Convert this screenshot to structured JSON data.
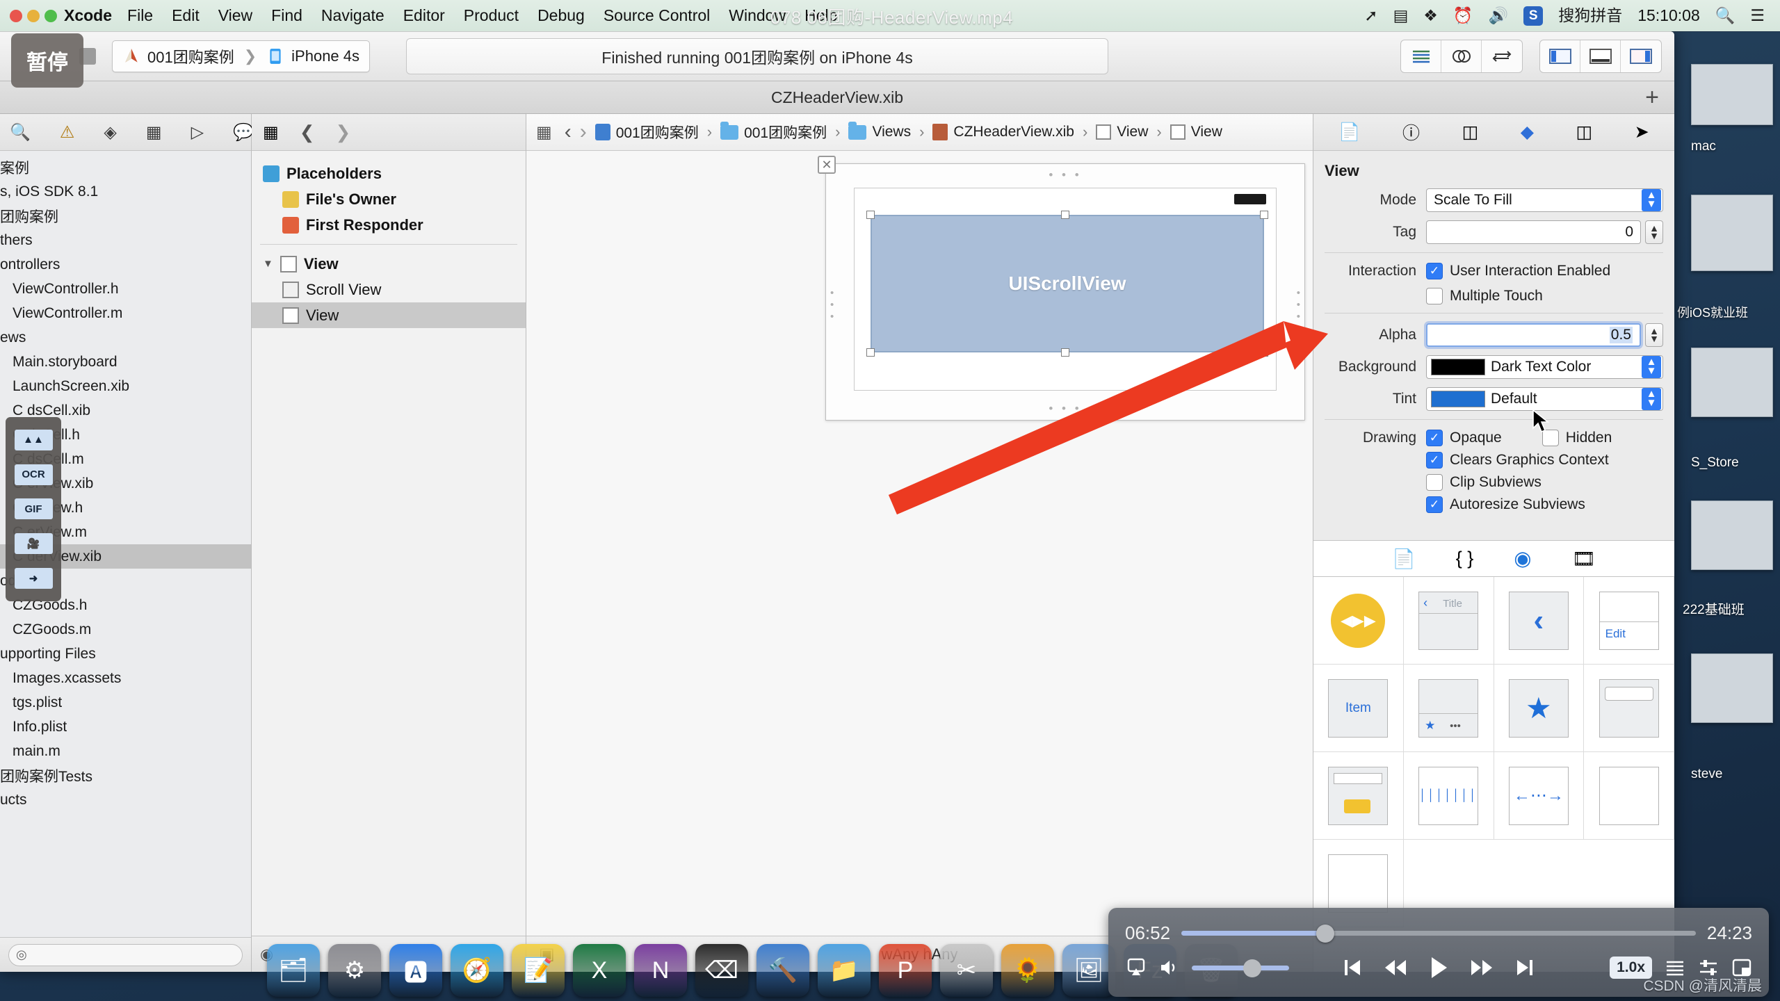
{
  "menubar": {
    "app_name": "Xcode",
    "items": [
      "File",
      "Edit",
      "View",
      "Find",
      "Navigate",
      "Editor",
      "Product",
      "Debug",
      "Source Control",
      "Window",
      "Help"
    ],
    "status_icons": [
      "airplay-icon",
      "facetime-camera-icon",
      "dropbox-icon",
      "time-machine-icon",
      "volume-icon",
      "sogou-input-icon",
      "search-icon",
      "notification-center-icon"
    ],
    "input_method": "搜狗拼音",
    "sogou_badge": "S",
    "clock": "15:10:08"
  },
  "video_overlay": {
    "filename": "078 06团购-HeaderView.mp4",
    "watermark": "CSDN @清风清晨"
  },
  "recorder": {
    "pause_label": "暂停",
    "buttons": [
      "screenshot-icon",
      "OCR",
      "GIF",
      "video-record-icon",
      "share-icon"
    ]
  },
  "xcode": {
    "toolbar": {
      "stop_button": "stop-button",
      "scheme_name": "001团购案例",
      "device_name": "iPhone 4s",
      "activity_status": "Finished running 001团购案例 on iPhone 4s",
      "editor_segments": [
        "standard-editor-icon",
        "assistant-editor-icon",
        "version-editor-icon"
      ],
      "view_segments": [
        "toggle-navigator-icon",
        "toggle-debug-area-icon",
        "toggle-utilities-icon"
      ]
    },
    "tabbar": {
      "title": "CZHeaderView.xib",
      "add_tab": "+"
    },
    "navigator": {
      "tabs": [
        "project-navigator-icon",
        "issue-navigator-icon",
        "test-navigator-icon",
        "debug-navigator-icon",
        "breakpoint-navigator-icon",
        "report-navigator-icon"
      ],
      "items": [
        {
          "label": "案例",
          "indent": 0,
          "selected": false
        },
        {
          "label": "s, iOS SDK 8.1",
          "indent": 0,
          "selected": false
        },
        {
          "label": "团购案例",
          "indent": 0,
          "selected": false
        },
        {
          "label": "thers",
          "indent": 0,
          "selected": false
        },
        {
          "label": "ontrollers",
          "indent": 0,
          "selected": false
        },
        {
          "label": "ViewController.h",
          "indent": 1,
          "selected": false
        },
        {
          "label": "ViewController.m",
          "indent": 1,
          "selected": false
        },
        {
          "label": "ews",
          "indent": 0,
          "selected": false
        },
        {
          "label": "Main.storyboard",
          "indent": 1,
          "selected": false
        },
        {
          "label": "LaunchScreen.xib",
          "indent": 1,
          "selected": false
        },
        {
          "label": "C        dsCell.xib",
          "indent": 1,
          "selected": false
        },
        {
          "label": "C        dsCell.h",
          "indent": 1,
          "selected": false
        },
        {
          "label": "C        dsCell.m",
          "indent": 1,
          "selected": false
        },
        {
          "label": "C        erView.xib",
          "indent": 1,
          "selected": false
        },
        {
          "label": "C        erView.h",
          "indent": 1,
          "selected": false
        },
        {
          "label": "C        erView.m",
          "indent": 1,
          "selected": false
        },
        {
          "label": "C        derView.xib",
          "indent": 1,
          "selected": true
        },
        {
          "label": "odels",
          "indent": 0,
          "selected": false
        },
        {
          "label": "CZGoods.h",
          "indent": 1,
          "selected": false
        },
        {
          "label": "CZGoods.m",
          "indent": 1,
          "selected": false
        },
        {
          "label": "upporting Files",
          "indent": 0,
          "selected": false
        },
        {
          "label": "Images.xcassets",
          "indent": 1,
          "selected": false
        },
        {
          "label": "tgs.plist",
          "indent": 1,
          "selected": false
        },
        {
          "label": "Info.plist",
          "indent": 1,
          "selected": false
        },
        {
          "label": "main.m",
          "indent": 1,
          "selected": false
        },
        {
          "label": "团购案例Tests",
          "indent": 0,
          "selected": false
        },
        {
          "label": "ucts",
          "indent": 0,
          "selected": false
        }
      ]
    },
    "outline": {
      "rows": [
        {
          "label": "Placeholders",
          "icon": "blue-cube-icon",
          "indent": 0,
          "bold": true,
          "selected": false
        },
        {
          "label": "File's Owner",
          "icon": "yellow-cube-icon",
          "indent": 1,
          "bold": true,
          "selected": false
        },
        {
          "label": "First Responder",
          "icon": "red-cube-icon",
          "indent": 1,
          "bold": true,
          "selected": false
        },
        {
          "label": "View",
          "icon": "view-icon",
          "indent": 0,
          "bold": true,
          "selected": false
        },
        {
          "label": "Scroll View",
          "icon": "scrollview-icon",
          "indent": 1,
          "bold": false,
          "selected": false
        },
        {
          "label": "View",
          "icon": "view-icon",
          "indent": 1,
          "bold": false,
          "selected": true
        }
      ]
    },
    "jumpbar": {
      "crumbs": [
        "001团购案例",
        "001团购案例",
        "Views",
        "CZHeaderView.xib",
        "View",
        "View"
      ],
      "icons": [
        "project-icon",
        "folder-icon",
        "folder-icon",
        "xib-icon",
        "view-icon",
        "view-icon"
      ]
    },
    "canvas": {
      "scrollview_label": "UIScrollView",
      "size_class": "wAny hAny"
    },
    "inspector": {
      "tabs": [
        "file-inspector-icon",
        "quick-help-icon",
        "identity-inspector-icon",
        "attributes-inspector-icon",
        "size-inspector-icon",
        "connections-inspector-icon"
      ],
      "section_title": "View",
      "mode_label": "Mode",
      "mode_value": "Scale To Fill",
      "tag_label": "Tag",
      "tag_value": "0",
      "interaction_label": "Interaction",
      "user_interaction_enabled": {
        "label": "User Interaction Enabled",
        "checked": true
      },
      "multiple_touch": {
        "label": "Multiple Touch",
        "checked": false
      },
      "alpha_label": "Alpha",
      "alpha_value": "0.5",
      "background_label": "Background",
      "background_value": "Dark Text Color",
      "background_color": "#000000",
      "tint_label": "Tint",
      "tint_value": "Default",
      "tint_color": "#1f6fd0",
      "drawing_label": "Drawing",
      "drawing_options": [
        {
          "label": "Opaque",
          "checked": true
        },
        {
          "label": "Hidden",
          "checked": false
        },
        {
          "label": "Clears Graphics Context",
          "checked": true
        },
        {
          "label": "Clip Subviews",
          "checked": false
        },
        {
          "label": "Autoresize Subviews",
          "checked": true
        }
      ]
    },
    "library": {
      "tabs": [
        "file-template-library-icon",
        "code-snippet-library-icon",
        "object-library-icon",
        "media-library-icon"
      ],
      "active_tab_index": 2,
      "cells": [
        {
          "kind": "media-controller",
          "label": ""
        },
        {
          "kind": "navigation-bar",
          "label": "Title"
        },
        {
          "kind": "back-chevron",
          "label": ""
        },
        {
          "kind": "edit-bar-button",
          "label": "Edit"
        },
        {
          "kind": "bar-button-item",
          "label": "Item"
        },
        {
          "kind": "toolbar",
          "label": ""
        },
        {
          "kind": "star-button",
          "label": ""
        },
        {
          "kind": "search-bar",
          "label": ""
        },
        {
          "kind": "tab-bar",
          "label": ""
        },
        {
          "kind": "page-control",
          "label": ""
        },
        {
          "kind": "stepper",
          "label": ""
        },
        {
          "kind": "plain-view",
          "label": ""
        },
        {
          "kind": "white-view",
          "label": ""
        }
      ]
    }
  },
  "dock": {
    "items": [
      "finder-icon",
      "system-preferences-icon",
      "app-store-icon",
      "safari-icon",
      "notes-icon",
      "excel-icon",
      "onenote-icon",
      "terminal-icon",
      "xcode-icon",
      "folder-icon",
      "paw-icon",
      "scissors-icon",
      "photos-icon",
      "preview-icon",
      "filezilla-icon",
      "trash-icon"
    ]
  },
  "desktop": {
    "labels": [
      "mac",
      "例iOS就业班",
      "S_Store",
      "222基础班",
      "steve"
    ]
  },
  "player": {
    "current_time": "06:52",
    "total_time": "24:23",
    "progress_percent": 28,
    "volume_percent": 62,
    "speed": "1.0x",
    "controls": [
      "airplay-icon",
      "volume-icon",
      "skip-to-start-icon",
      "rewind-icon",
      "play-icon",
      "fast-forward-icon",
      "skip-to-end-icon",
      "playback-speed-button",
      "playlist-icon",
      "equalizer-icon",
      "picture-in-picture-icon"
    ]
  }
}
